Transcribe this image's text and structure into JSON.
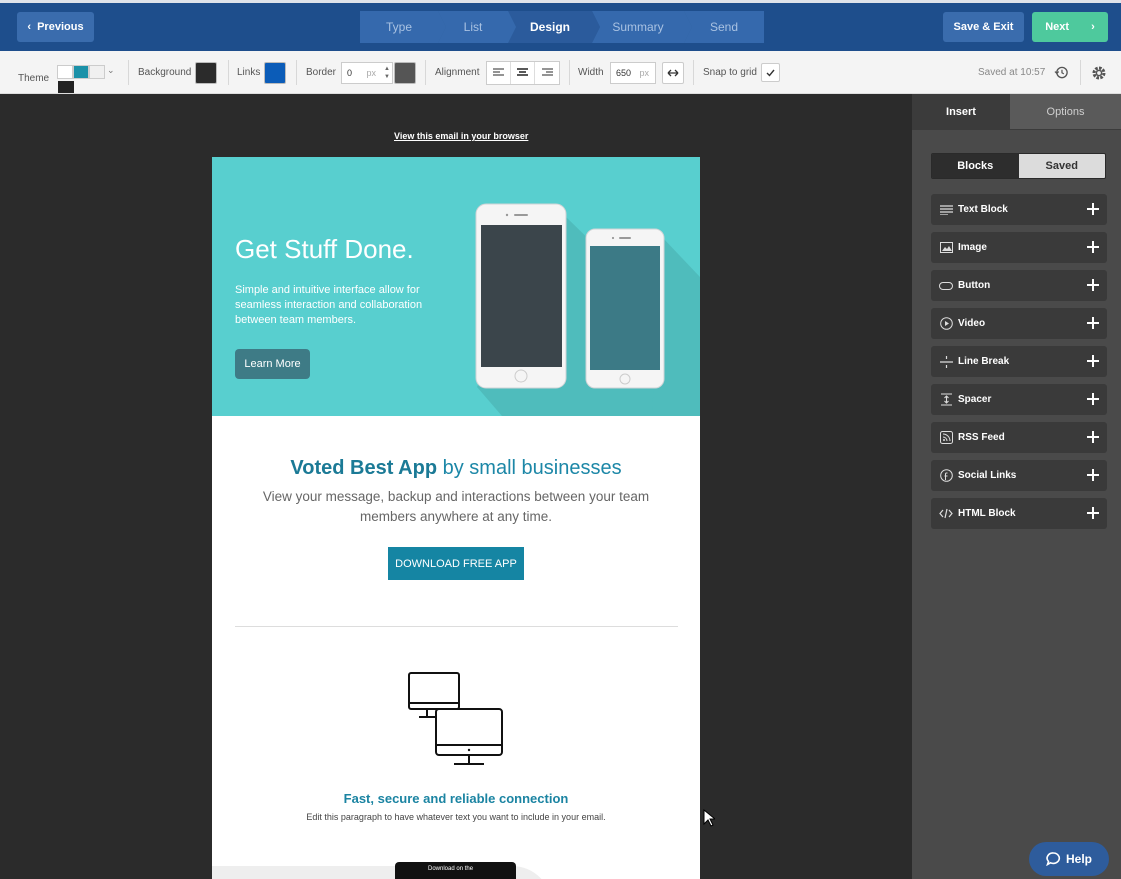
{
  "topbar": {
    "previous_label": "Previous",
    "steps": [
      "Type",
      "List",
      "Design",
      "Summary",
      "Send"
    ],
    "active_step": "Design",
    "save_exit_label": "Save & Exit",
    "next_label": "Next"
  },
  "toolbar": {
    "theme_label": "Theme",
    "background_label": "Background",
    "background_color": "#2b2b2b",
    "links_label": "Links",
    "links_color": "#0b5cb8",
    "border_label": "Border",
    "border_value": "0",
    "border_unit": "px",
    "border_color": "#555555",
    "alignment_label": "Alignment",
    "width_label": "Width",
    "width_value": "650",
    "width_unit": "px",
    "snap_label": "Snap to grid",
    "saved_text": "Saved at 10:57"
  },
  "canvas": {
    "view_link": "View this email in your browser",
    "hero": {
      "title": "Get Stuff Done.",
      "subtitle": "Simple and intuitive interface allow for seamless interaction and collaboration between team members.",
      "button": "Learn More"
    },
    "promo": {
      "title_bold": "Voted Best App",
      "title_rest": " by small businesses",
      "subtitle": "View your message, backup and interactions between your team members anywhere at any time.",
      "button": "DOWNLOAD FREE APP"
    },
    "feature": {
      "title": "Fast, secure and reliable connection",
      "subtitle": "Edit this paragraph to have whatever text you want to include in your email."
    },
    "appstore_label": "Download on the"
  },
  "sidebar": {
    "tabs": [
      "Insert",
      "Options"
    ],
    "segments": [
      "Blocks",
      "Saved"
    ],
    "blocks": [
      {
        "label": "Text Block",
        "icon": "text-lines-icon"
      },
      {
        "label": "Image",
        "icon": "image-icon"
      },
      {
        "label": "Button",
        "icon": "button-shape-icon"
      },
      {
        "label": "Video",
        "icon": "play-circle-icon"
      },
      {
        "label": "Line Break",
        "icon": "line-break-icon"
      },
      {
        "label": "Spacer",
        "icon": "spacer-icon"
      },
      {
        "label": "RSS Feed",
        "icon": "rss-icon"
      },
      {
        "label": "Social Links",
        "icon": "social-icon"
      },
      {
        "label": "HTML Block",
        "icon": "code-icon"
      }
    ],
    "help_label": "Help"
  }
}
